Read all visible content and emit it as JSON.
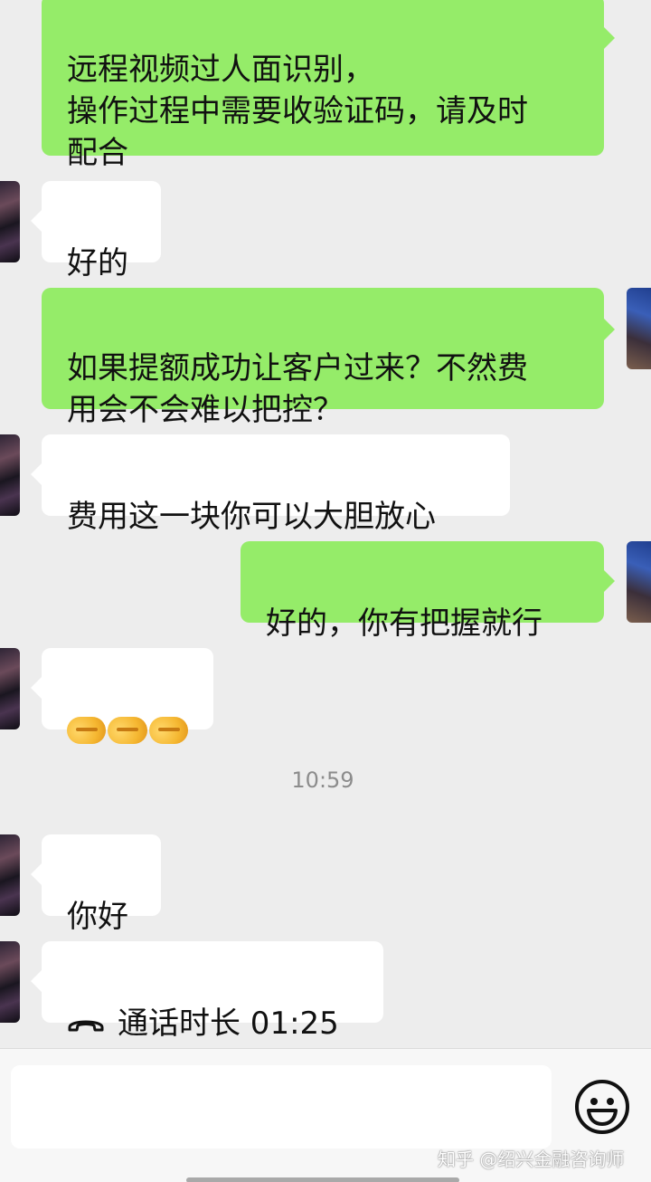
{
  "messages": [
    {
      "dir": "out",
      "text": "远程视频过人面识别，\n操作过程中需要收验证码，请及时\n配合"
    },
    {
      "dir": "in",
      "text": "好的"
    },
    {
      "dir": "out",
      "text": "如果提额成功让客户过来？不然费\n用会不会难以把控？"
    },
    {
      "dir": "in",
      "text": "费用这一块你可以大胆放心"
    },
    {
      "dir": "out",
      "text": "好的，你有把握就行"
    },
    {
      "dir": "in",
      "emoji": [
        "handshake-emoji",
        "handshake-emoji",
        "handshake-emoji"
      ]
    },
    {
      "dir": "in",
      "text": "你好"
    },
    {
      "dir": "in",
      "call_label": "通话时长 01:25",
      "icon": "phone-hangup-icon"
    }
  ],
  "timestamp": "10:59",
  "composer": {
    "input_value": "",
    "emoji_button": "smiley-icon"
  },
  "watermark": "知乎 @绍兴金融咨询师"
}
